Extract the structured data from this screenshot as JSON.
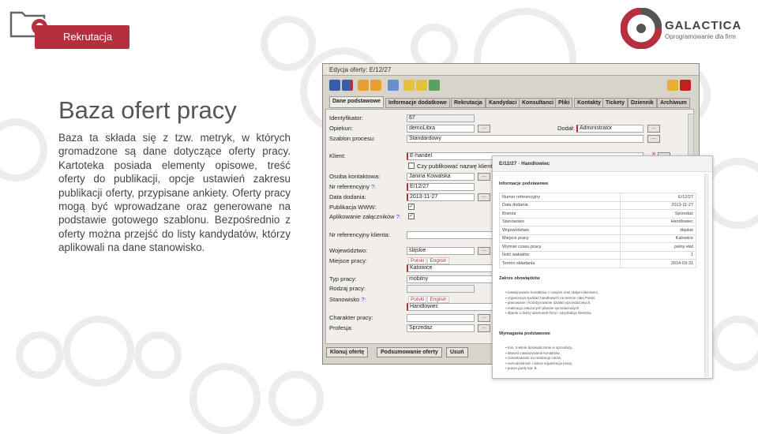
{
  "header": {
    "tag": "Rekrutacja",
    "logo_name": "GALACTICA",
    "logo_sub": "Oprogramowanie dla firm"
  },
  "slide": {
    "title": "Baza ofert pracy",
    "text": "Baza ta składa się z tzw. metryk, w których gromadzone są dane dotyczące oferty pracy. Kartoteka posiada elementy opisowe, treść oferty do publikacji, opcje ustawień zakresu publikacji oferty, przypisane ankiety. Oferty pracy mogą być wprowadzane oraz generowane na podstawie gotowego szablonu. Bezpośrednio z oferty można przejść do listy kandydatów, którzy aplikowali na dane stanowisko."
  },
  "window": {
    "title": "Edycja oferty: E/12/27",
    "tabs": [
      "Dane podstawowe",
      "Informacje dodatkowe",
      "Rekrutacja",
      "Kandydaci",
      "Konsultanci",
      "Pliki",
      "Kontakty",
      "Tickety",
      "Dziennik",
      "Archiwum"
    ],
    "labels": {
      "identyfikator": "Identyfikator:",
      "opiekun": "Opiekun:",
      "dodal": "Dodał:",
      "szablon": "Szablon procesu:",
      "klient": "Klient:",
      "czy_publikowac": "Czy publikować nazwę klienta",
      "osoba": "Osoba kontaktowa:",
      "nr_ref": "Nr referencyjny ",
      "data_dodania": "Data dodania:",
      "publikacja": "Publikacja WWW:",
      "aplikowanie": "Aplikowanie załączników ",
      "nr_ref_klienta": "Nr referencyjny klienta:",
      "wojewodztwo": "Województwo:",
      "miejsce": "Miejsce pracy:",
      "typ": "Typ pracy:",
      "rodzaj": "Rodzaj pracy:",
      "stanowisko": "Stanowisko ",
      "charakter": "Charakter pracy:",
      "profesja": "Profesja:",
      "q": "?:"
    },
    "values": {
      "identyfikator": "67",
      "opiekun": "demoLibra",
      "dodal": "Administrator",
      "szablon": "Standardowy",
      "klient": "E-handel",
      "osoba": "Janina Kowalska",
      "nr_ref": "E/12/27",
      "data_dodania": "2013-11-27",
      "wojewodztwo": "śląskie",
      "miejsce": "Katowice",
      "typ": "mobilny",
      "stanowisko": "Handlowiec",
      "profesja": "Sprzedaż"
    },
    "lang_tabs": [
      "Polski",
      "English"
    ],
    "buttons": {
      "clone": "Klonuj ofertę",
      "summary": "Podsumowanie oferty",
      "delete": "Usuń"
    },
    "btn_dots": "...",
    "btn_arrows": "»"
  },
  "popup": {
    "header": "E/12/27 · Handlowiec",
    "section_info": "Informacje podstawowe",
    "rows": [
      {
        "k": "Numer referencyjny",
        "v": "E/12/27"
      },
      {
        "k": "Data dodania",
        "v": "2013-11-27"
      },
      {
        "k": "Branża",
        "v": "Sprzedaż"
      },
      {
        "k": "Stanowisko",
        "v": "Handlowiec"
      },
      {
        "k": "Województwo",
        "v": "śląskie"
      },
      {
        "k": "Miejsce pracy",
        "v": "Katowice"
      },
      {
        "k": "Wymiar czasu pracy",
        "v": "pełny etat"
      },
      {
        "k": "Ilość wakatów",
        "v": "1"
      },
      {
        "k": "Termin składania",
        "v": "2014-03-31"
      }
    ],
    "section_duties": "Zakres obowiązków",
    "duties": [
      "nawiązywanie kontaktów z nowymi oraz stałymi klientami,",
      "organizacja spotkań handlowych na terenie całej Polski,",
      "planowanie i koordynowanie działań sprzedażowych,",
      "realizacja założonych planów sprzedażowych,",
      "dbanie o dobry wizerunek firmy i satysfakcję klientów."
    ],
    "section_req": "Wymagania podstawowe",
    "requirements": [
      "min. 2-letnie doświadczenie w sprzedaży,",
      "łatwość nawiązywania kontaktów,",
      "zorientowanie na realizację celów,",
      "samodzielność i dobra organizacja pracy,",
      "prawo jazdy kat. B."
    ]
  },
  "colors": {
    "accent": "#b62f3e",
    "window_bg": "#d8d4cc"
  }
}
